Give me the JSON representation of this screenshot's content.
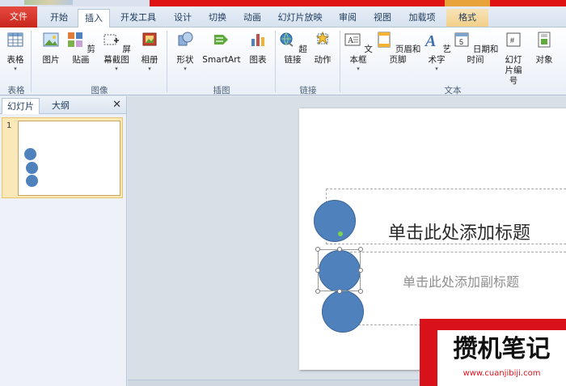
{
  "tabs": {
    "file": "文件",
    "items": [
      "开始",
      "插入",
      "开发工具",
      "设计",
      "切换",
      "动画",
      "幻灯片放映",
      "审阅",
      "视图",
      "加载项",
      "格式"
    ],
    "active": "插入"
  },
  "ribbon": {
    "buttons": [
      {
        "label": "表格",
        "icon": "table-icon"
      },
      {
        "label": "图片",
        "icon": "picture-icon"
      },
      {
        "label": "剪贴画",
        "icon": "clipart-icon"
      },
      {
        "label": "屏幕截图",
        "icon": "screenshot-icon"
      },
      {
        "label": "相册",
        "icon": "album-icon"
      },
      {
        "label": "形状",
        "icon": "shapes-icon"
      },
      {
        "label": "SmartArt",
        "icon": "smartart-icon"
      },
      {
        "label": "图表",
        "icon": "chart-icon"
      },
      {
        "label": "超链接",
        "icon": "hyperlink-icon"
      },
      {
        "label": "动作",
        "icon": "action-icon"
      },
      {
        "label": "文本框",
        "icon": "textbox-icon"
      },
      {
        "label": "页眉和页脚",
        "icon": "header-footer-icon"
      },
      {
        "label": "艺术字",
        "icon": "wordart-icon"
      },
      {
        "label": "日期和时间",
        "icon": "date-time-icon"
      },
      {
        "label": "幻灯",
        "label2": "片编号",
        "icon": "slide-number-icon"
      },
      {
        "label": "对象",
        "icon": "object-icon"
      }
    ],
    "groups": [
      "表格",
      "图像",
      "插图",
      "链接",
      "文本"
    ]
  },
  "pane": {
    "tabs": [
      "幻灯片",
      "大纲"
    ],
    "close": "✕",
    "slide_number": "1"
  },
  "slide": {
    "title_placeholder": "单击此处添加标题",
    "subtitle_placeholder": "单击此处添加副标题"
  },
  "watermark": {
    "text": "攒机笔记",
    "url": "www.cuanjibiji.com"
  },
  "colors": {
    "shape_fill": "#4f81bd",
    "file_tab": "#d9342a",
    "accent": "#1e3b5c"
  }
}
